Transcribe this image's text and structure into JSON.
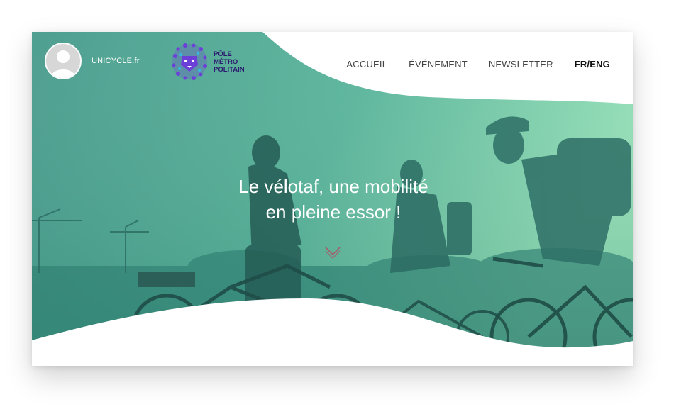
{
  "header": {
    "site_name": "UNICYCLE.fr",
    "logo_lines": [
      "PÔLE",
      "MÉTRO",
      "POLITAIN"
    ]
  },
  "nav": {
    "items": [
      {
        "label": "ACCUEIL"
      },
      {
        "label": "ÉVÉNEMENT"
      },
      {
        "label": "NEWSLETTER"
      },
      {
        "label": "FR/ENG"
      }
    ]
  },
  "hero": {
    "title_line1": "Le vélotaf, une mobilité",
    "title_line2": "en pleine essor !"
  },
  "icons": {
    "avatar": "user-avatar",
    "logo": "lion-logo-icon",
    "scroll": "chevron-down-icon"
  },
  "colors": {
    "overlay_dark": "#2f7f78",
    "overlay_light": "#8fe0b4",
    "logo_purple": "#6b3fd8",
    "logo_text": "#2a1b6e"
  }
}
